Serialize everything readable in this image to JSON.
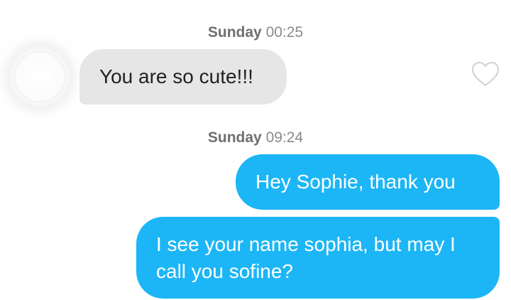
{
  "messages": [
    {
      "timestamp": {
        "day": "Sunday",
        "time": "00:25"
      },
      "direction": "incoming",
      "text": "You are so cute!!!",
      "bubble_color": "#e6e6e6"
    },
    {
      "timestamp": {
        "day": "Sunday",
        "time": "09:24"
      },
      "direction": "outgoing",
      "text": "Hey Sophie, thank you",
      "bubble_color": "#1cb6f6"
    },
    {
      "direction": "outgoing",
      "text": "I see your name sophia, but may I call you sofine?",
      "bubble_color": "#1cb6f6"
    }
  ],
  "icons": {
    "like": "heart-outline-icon",
    "avatar": "avatar"
  },
  "colors": {
    "outgoing_bubble": "#1cb6f6",
    "incoming_bubble": "#e6e6e6",
    "timestamp": "#6f6f6f"
  }
}
